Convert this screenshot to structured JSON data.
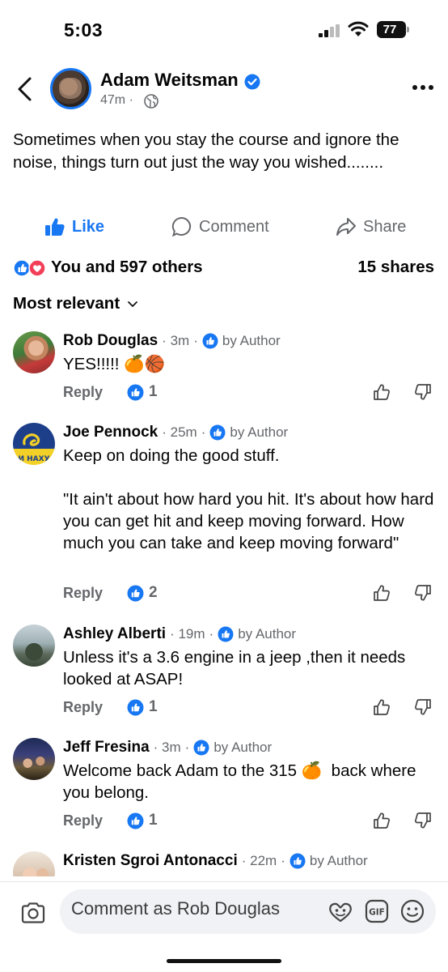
{
  "status_bar": {
    "time": "5:03",
    "battery": "77"
  },
  "post": {
    "author": "Adam Weitsman",
    "time": "47m",
    "text": "Sometimes when you stay the course and ignore the noise, things turn out just the way you wished........"
  },
  "actions": {
    "like": "Like",
    "comment": "Comment",
    "share": "Share"
  },
  "reactions": {
    "summary": "You and 597 others",
    "shares": "15 shares"
  },
  "sort_label": "Most relevant",
  "comments": [
    {
      "name": "Rob Douglas",
      "time": "3m",
      "badge": "by Author",
      "text": "YES!!!!! 🍊🏀",
      "reply": "Reply",
      "likes": "1"
    },
    {
      "name": "Joe Pennock",
      "time": "25m",
      "badge": "by Author",
      "text": "Keep on doing the good stuff.\n\n\"It ain't about how hard you hit. It's about how hard you can get hit and keep moving forward. How much you can take and keep moving forward\"",
      "reply": "Reply",
      "likes": "2",
      "avatar_text": "И НАХУ"
    },
    {
      "name": "Ashley Alberti",
      "time": "19m",
      "badge": "by Author",
      "text": "Unless it's a 3.6 engine in a jeep ,then it needs looked at ASAP!",
      "reply": "Reply",
      "likes": "1"
    },
    {
      "name": "Jeff Fresina",
      "time": "3m",
      "badge": "by Author",
      "text": "Welcome back Adam to the 315 🍊  back where you belong.",
      "reply": "Reply",
      "likes": "1"
    },
    {
      "name": "Kristen Sgroi Antonacci",
      "time": "22m",
      "badge": "by Author"
    }
  ],
  "composer": {
    "placeholder": "Comment as Rob Douglas"
  },
  "colors": {
    "accent": "#1877f2",
    "secondary_text": "#65676b",
    "heart": "#f33e58"
  }
}
